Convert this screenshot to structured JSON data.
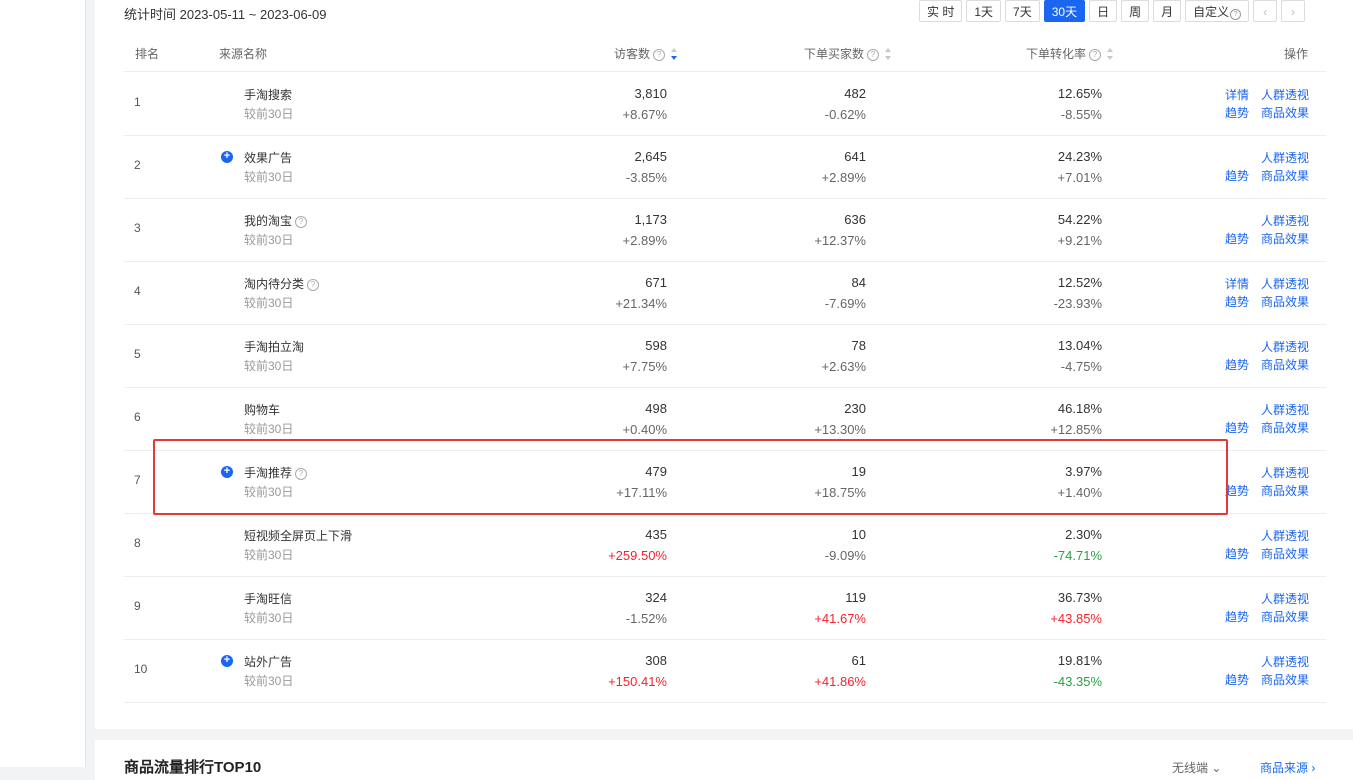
{
  "stat_label": "统计时间 2023-05-11 ~ 2023-06-09",
  "periods": [
    "实 时",
    "1天",
    "7天",
    "30天",
    "日",
    "周",
    "月",
    "自定义"
  ],
  "active_period": "30天",
  "nav": {
    "prev": "‹",
    "next": "›"
  },
  "headers": {
    "rank": "排名",
    "source": "来源名称",
    "visitors": "访客数",
    "buyers": "下单买家数",
    "conversion": "下单转化率",
    "action": "操作"
  },
  "rows": [
    {
      "rank": "1",
      "name": "手淘搜索",
      "plus": false,
      "help": false,
      "compare": "较前30日",
      "visitors": "3,810",
      "visitors_change": "+8.67%",
      "buyers": "482",
      "buyers_change": "-0.62%",
      "conv": "12.65%",
      "conv_change": "-8.55%",
      "ops": [
        "详情",
        "人群透视",
        "趋势",
        "商品效果"
      ]
    },
    {
      "rank": "2",
      "name": "效果广告",
      "plus": true,
      "help": false,
      "compare": "较前30日",
      "visitors": "2,645",
      "visitors_change": "-3.85%",
      "buyers": "641",
      "buyers_change": "+2.89%",
      "conv": "24.23%",
      "conv_change": "+7.01%",
      "ops": [
        "",
        "人群透视",
        "趋势",
        "商品效果"
      ]
    },
    {
      "rank": "3",
      "name": "我的淘宝",
      "plus": false,
      "help": true,
      "compare": "较前30日",
      "visitors": "1,173",
      "visitors_change": "+2.89%",
      "buyers": "636",
      "buyers_change": "+12.37%",
      "conv": "54.22%",
      "conv_change": "+9.21%",
      "ops": [
        "",
        "人群透视",
        "趋势",
        "商品效果"
      ]
    },
    {
      "rank": "4",
      "name": "淘内待分类",
      "plus": false,
      "help": true,
      "compare": "较前30日",
      "visitors": "671",
      "visitors_change": "+21.34%",
      "buyers": "84",
      "buyers_change": "-7.69%",
      "conv": "12.52%",
      "conv_change": "-23.93%",
      "ops": [
        "详情",
        "人群透视",
        "趋势",
        "商品效果"
      ]
    },
    {
      "rank": "5",
      "name": "手淘拍立淘",
      "plus": false,
      "help": false,
      "compare": "较前30日",
      "visitors": "598",
      "visitors_change": "+7.75%",
      "buyers": "78",
      "buyers_change": "+2.63%",
      "conv": "13.04%",
      "conv_change": "-4.75%",
      "ops": [
        "",
        "人群透视",
        "趋势",
        "商品效果"
      ]
    },
    {
      "rank": "6",
      "name": "购物车",
      "plus": false,
      "help": false,
      "compare": "较前30日",
      "visitors": "498",
      "visitors_change": "+0.40%",
      "buyers": "230",
      "buyers_change": "+13.30%",
      "conv": "46.18%",
      "conv_change": "+12.85%",
      "ops": [
        "",
        "人群透视",
        "趋势",
        "商品效果"
      ]
    },
    {
      "rank": "7",
      "name": "手淘推荐",
      "plus": true,
      "help": true,
      "compare": "较前30日",
      "visitors": "479",
      "visitors_change": "+17.11%",
      "buyers": "19",
      "buyers_change": "+18.75%",
      "conv": "3.97%",
      "conv_change": "+1.40%",
      "ops": [
        "",
        "人群透视",
        "趋势",
        "商品效果"
      ]
    },
    {
      "rank": "8",
      "name": "短视频全屏页上下滑",
      "plus": false,
      "help": false,
      "compare": "较前30日",
      "visitors": "435",
      "visitors_change": "+259.50%",
      "visitors_change_color": "red",
      "buyers": "10",
      "buyers_change": "-9.09%",
      "conv": "2.30%",
      "conv_change": "-74.71%",
      "conv_change_color": "green",
      "ops": [
        "",
        "人群透视",
        "趋势",
        "商品效果"
      ]
    },
    {
      "rank": "9",
      "name": "手淘旺信",
      "plus": false,
      "help": false,
      "compare": "较前30日",
      "visitors": "324",
      "visitors_change": "-1.52%",
      "buyers": "119",
      "buyers_change": "+41.67%",
      "buyers_change_color": "red",
      "conv": "36.73%",
      "conv_change": "+43.85%",
      "conv_change_color": "red",
      "ops": [
        "",
        "人群透视",
        "趋势",
        "商品效果"
      ]
    },
    {
      "rank": "10",
      "name": "站外广告",
      "plus": true,
      "help": false,
      "compare": "较前30日",
      "visitors": "308",
      "visitors_change": "+150.41%",
      "visitors_change_color": "red",
      "buyers": "61",
      "buyers_change": "+41.86%",
      "buyers_change_color": "red",
      "conv": "19.81%",
      "conv_change": "-43.35%",
      "conv_change_color": "green",
      "ops": [
        "",
        "人群透视",
        "趋势",
        "商品效果"
      ]
    }
  ],
  "bottom": {
    "title": "商品流量排行TOP10",
    "device": "无线端",
    "link": "商品来源"
  },
  "colors": {
    "accent": "#1a66f0",
    "up": "#f5222d",
    "down": "#27a243",
    "highlight": "#e53935"
  }
}
